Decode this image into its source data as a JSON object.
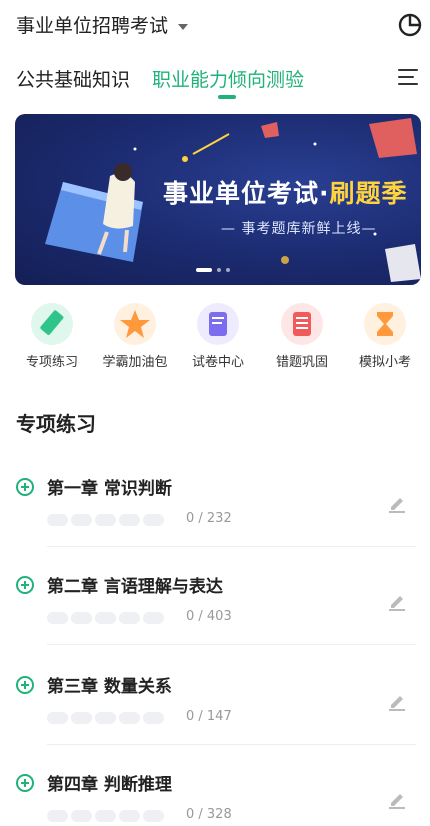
{
  "header": {
    "exam_title": "事业单位招聘考试",
    "stats_icon": "pie-chart-icon"
  },
  "tabs": [
    {
      "label": "公共基础知识",
      "active": false
    },
    {
      "label": "职业能力倾向测验",
      "active": true
    }
  ],
  "menu_icon": "list-menu-icon",
  "banner": {
    "title_main": "事业单位考试·",
    "title_highlight": "刷题季",
    "subtitle": "— 事考题库新鲜上线—",
    "indicator_count": 3,
    "active_index": 0
  },
  "features": [
    {
      "label": "专项练习",
      "icon": "pencil-icon",
      "color": "#2ec48a"
    },
    {
      "label": "学霸加油包",
      "icon": "star-icon",
      "color": "#ff9a3c"
    },
    {
      "label": "试卷中心",
      "icon": "paper-icon",
      "color": "#7b6cf0"
    },
    {
      "label": "错题巩固",
      "icon": "notebook-icon",
      "color": "#f05a5a"
    },
    {
      "label": "模拟小考",
      "icon": "hourglass-icon",
      "color": "#ff9a3c"
    }
  ],
  "section_title": "专项练习",
  "chapters": [
    {
      "name": "第一章 常识判断",
      "count": "0 / 232"
    },
    {
      "name": "第二章 言语理解与表达",
      "count": "0 / 403"
    },
    {
      "name": "第三章 数量关系",
      "count": "0 / 147"
    },
    {
      "name": "第四章 判断推理",
      "count": "0 / 328"
    }
  ],
  "colors": {
    "accent": "#20b27a",
    "banner_bg": "#1b2a6e",
    "highlight": "#ffd33d"
  }
}
